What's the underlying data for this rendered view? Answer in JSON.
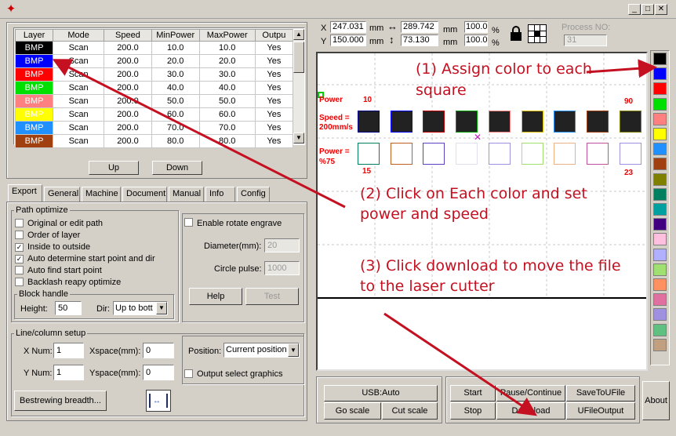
{
  "window": {
    "min": "_",
    "max": "□",
    "close": "✕"
  },
  "layers": {
    "headers": [
      "Layer",
      "Mode",
      "Speed",
      "MinPower",
      "MaxPower",
      "Outpu"
    ],
    "rows": [
      {
        "layer": "BMP",
        "color": "#000000",
        "mode": "Scan",
        "speed": "200.0",
        "min": "10.0",
        "max": "10.0",
        "out": "Yes"
      },
      {
        "layer": "BMP",
        "color": "#0000ff",
        "mode": "Scan",
        "speed": "200.0",
        "min": "20.0",
        "max": "20.0",
        "out": "Yes"
      },
      {
        "layer": "BMP",
        "color": "#ff0000",
        "mode": "Scan",
        "speed": "200.0",
        "min": "30.0",
        "max": "30.0",
        "out": "Yes"
      },
      {
        "layer": "BMP",
        "color": "#00e000",
        "mode": "Scan",
        "speed": "200.0",
        "min": "40.0",
        "max": "40.0",
        "out": "Yes"
      },
      {
        "layer": "BMP",
        "color": "#ff8080",
        "mode": "Scan",
        "speed": "200.0",
        "min": "50.0",
        "max": "50.0",
        "out": "Yes"
      },
      {
        "layer": "BMP",
        "color": "#ffff00",
        "mode": "Scan",
        "speed": "200.0",
        "min": "60.0",
        "max": "60.0",
        "out": "Yes"
      },
      {
        "layer": "BMP",
        "color": "#2090ff",
        "mode": "Scan",
        "speed": "200.0",
        "min": "70.0",
        "max": "70.0",
        "out": "Yes"
      },
      {
        "layer": "BMP",
        "color": "#a04010",
        "mode": "Scan",
        "speed": "200.0",
        "min": "80.0",
        "max": "80.0",
        "out": "Yes"
      }
    ],
    "up": "Up",
    "down": "Down"
  },
  "tabs": [
    "Export",
    "General",
    "Machine",
    "Document",
    "Manual",
    "Info",
    "Config"
  ],
  "path_optimize": {
    "title": "Path optimize",
    "options": [
      {
        "label": "Original or edit path",
        "checked": false
      },
      {
        "label": "Order of layer",
        "checked": false
      },
      {
        "label": "Inside to outside",
        "checked": true
      },
      {
        "label": "Auto determine start point and dir",
        "checked": true
      },
      {
        "label": "Auto find start point",
        "checked": false
      },
      {
        "label": "Backlash reapy optimize",
        "checked": false
      }
    ],
    "block_title": "Block handle",
    "height_label": "Height:",
    "height_value": "50",
    "dir_label": "Dir:",
    "dir_value": "Up to bott"
  },
  "rotate": {
    "enable_label": "Enable rotate engrave",
    "diameter_label": "Diameter(mm):",
    "diameter_value": "20",
    "pulse_label": "Circle pulse:",
    "pulse_value": "1000",
    "help": "Help",
    "test": "Test"
  },
  "linecol": {
    "title": "Line/column setup",
    "xnum_label": "X Num:",
    "xnum": "1",
    "xspace_label": "Xspace(mm):",
    "xspace": "0",
    "ynum_label": "Y Num:",
    "ynum": "1",
    "yspace_label": "Yspace(mm):",
    "yspace": "0",
    "bestrew": "Bestrewing breadth...",
    "position_label": "Position:",
    "position_value": "Current position",
    "output_select": "Output select graphics"
  },
  "coords": {
    "x_label": "X",
    "x": "247.031",
    "y_label": "Y",
    "y": "150.000",
    "w": "289.742",
    "h": "73.130",
    "unit": "mm",
    "sx": "100.0",
    "sy": "100.0",
    "pct": "%",
    "process_label": "Process NO:",
    "process": "31"
  },
  "canvas": {
    "power_label": "Power",
    "speed_label": "Speed =",
    "speed_value": "200mm/s",
    "power2_label": "Power =",
    "power2_value": "%75",
    "n10": "10",
    "n90": "90",
    "n15": "15",
    "n23": "23",
    "row1_colors": [
      "#000080",
      "#0000ff",
      "#c00000",
      "#00a000",
      "#ff8080",
      "#e0c000",
      "#2090ff",
      "#a04010",
      "#808000"
    ],
    "row2_colors": [
      "#008060",
      "#c06020",
      "#6040c0",
      "#e0e0f0",
      "#a090e0",
      "#a0e070",
      "#f0b080",
      "#c050a0",
      "#a090e0"
    ]
  },
  "annotations": {
    "a1_line1": "(1) Assign color to each",
    "a1_line2": "square",
    "a2_line1": "(2) Click on Each color and set",
    "a2_line2": "power and speed",
    "a3_line1": "(3) Click download to move the file",
    "a3_line2": "to the laser cutter"
  },
  "palette": [
    "#000000",
    "#0000ff",
    "#ff0000",
    "#00e000",
    "#ff8080",
    "#ffff00",
    "#2090ff",
    "#a04010",
    "#808000",
    "#008060",
    "#00a0a0",
    "#400080",
    "#ffc0e0",
    "#b0b0ff",
    "#a0e070",
    "#ff9060",
    "#e070a0",
    "#a090e0",
    "#60c080",
    "#c0a080"
  ],
  "bottom": {
    "usb": "USB:Auto",
    "goscale": "Go scale",
    "cutscale": "Cut scale",
    "start": "Start",
    "pause": "Pause/Continue",
    "save": "SaveToUFile",
    "stop": "Stop",
    "download": "Download",
    "ufile": "UFileOutput",
    "about": "About"
  }
}
